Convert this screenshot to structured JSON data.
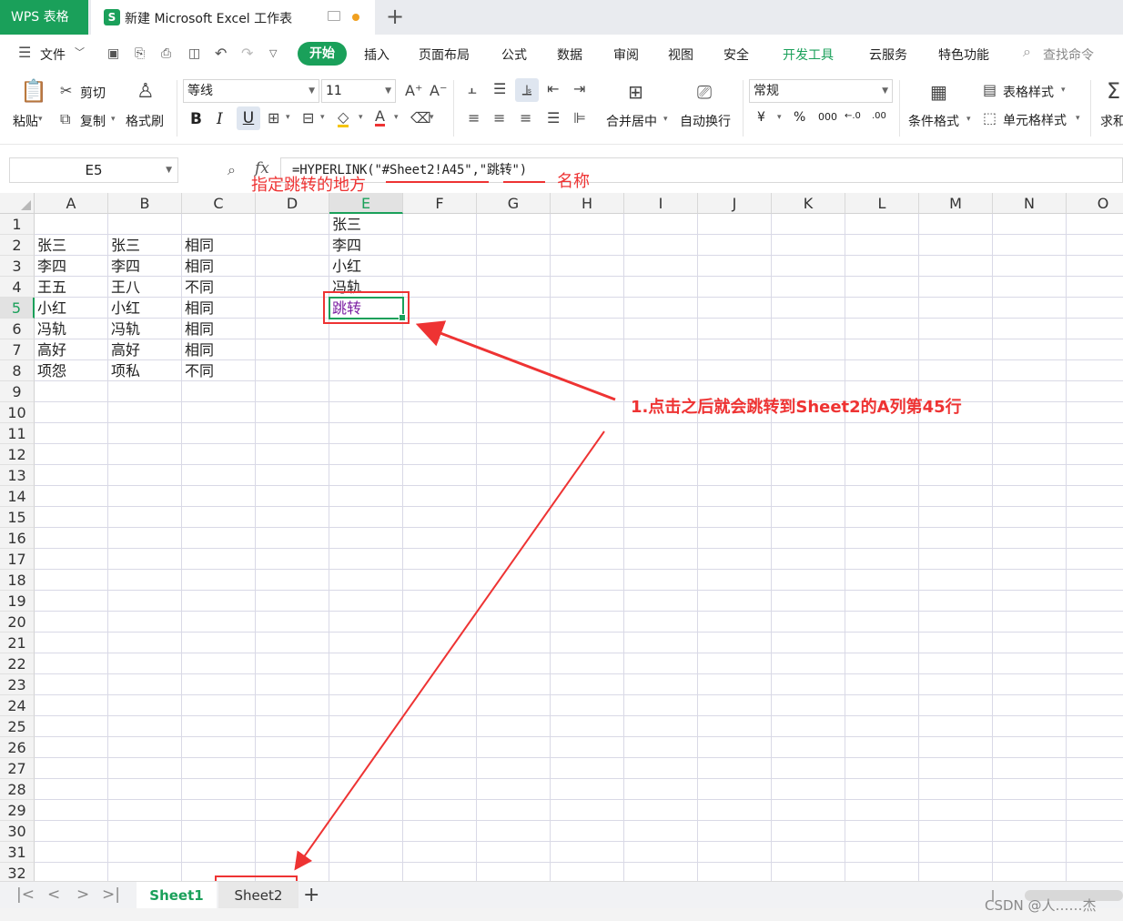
{
  "titlebar": {
    "app_tab": "WPS 表格",
    "doc_icon": "S",
    "doc_title": "新建 Microsoft Excel 工作表",
    "new_tab": "+"
  },
  "menu": {
    "file": "文件",
    "items": [
      "开始",
      "插入",
      "页面布局",
      "公式",
      "数据",
      "审阅",
      "视图",
      "安全",
      "开发工具",
      "云服务",
      "特色功能"
    ],
    "active": "开始",
    "search": "查找命令"
  },
  "toolbar": {
    "paste": "粘贴",
    "cut": "剪切",
    "copy": "复制",
    "format_painter": "格式刷",
    "font_name": "等线",
    "font_size": "11",
    "number_format": "常规",
    "merge_center": "合并居中",
    "wrap_text": "自动换行",
    "conditional_format": "条件格式",
    "table_style": "表格样式",
    "cell_style": "单元格样式",
    "sum": "求和",
    "bold": "B",
    "italic": "I",
    "underline": "U",
    "currency": "¥",
    "percent": "%",
    "thousands": "000",
    "inc_decimal": "←.0",
    "dec_decimal": ".00"
  },
  "formula_bar": {
    "cell_ref": "E5",
    "fx": "fx",
    "formula": "=HYPERLINK(\"#Sheet2!A45\",\"跳转\")"
  },
  "sheet": {
    "columns": [
      "A",
      "B",
      "C",
      "D",
      "E",
      "F",
      "G",
      "H",
      "I",
      "J",
      "K",
      "L",
      "M",
      "N",
      "O"
    ],
    "selected_column": "E",
    "selected_row": 5,
    "rows": [
      "1",
      "2",
      "3",
      "4",
      "5",
      "6",
      "7",
      "8",
      "9",
      "10",
      "11",
      "12",
      "13",
      "14",
      "15",
      "16",
      "17",
      "18",
      "19",
      "20",
      "21",
      "22",
      "23",
      "24",
      "25",
      "26",
      "27",
      "28",
      "29",
      "30",
      "31",
      "32"
    ],
    "col_a": [
      "",
      "张三",
      "李四",
      "王五",
      "小红",
      "冯轨",
      "高好",
      "项怨"
    ],
    "col_b": [
      "",
      "张三",
      "李四",
      "王八",
      "小红",
      "冯轨",
      "高好",
      "项私"
    ],
    "col_c": [
      "",
      "相同",
      "相同",
      "不同",
      "相同",
      "相同",
      "相同",
      "不同"
    ],
    "col_e": [
      "张三",
      "李四",
      "小红",
      "冯轨",
      "跳转"
    ]
  },
  "tabs": {
    "sheet1": "Sheet1",
    "sheet2": "Sheet2",
    "add": "+"
  },
  "annotations": {
    "target_label": "指定跳转的地方",
    "name_label": "名称",
    "note": "1.点击之后就会跳转到Sheet2的A列第45行",
    "color": "#e33333"
  },
  "watermark": "CSDN @人……杰",
  "colors": {
    "brand_green": "#1aa05a",
    "link_purple": "#7b1fa2",
    "annotation_red": "#e33333"
  }
}
